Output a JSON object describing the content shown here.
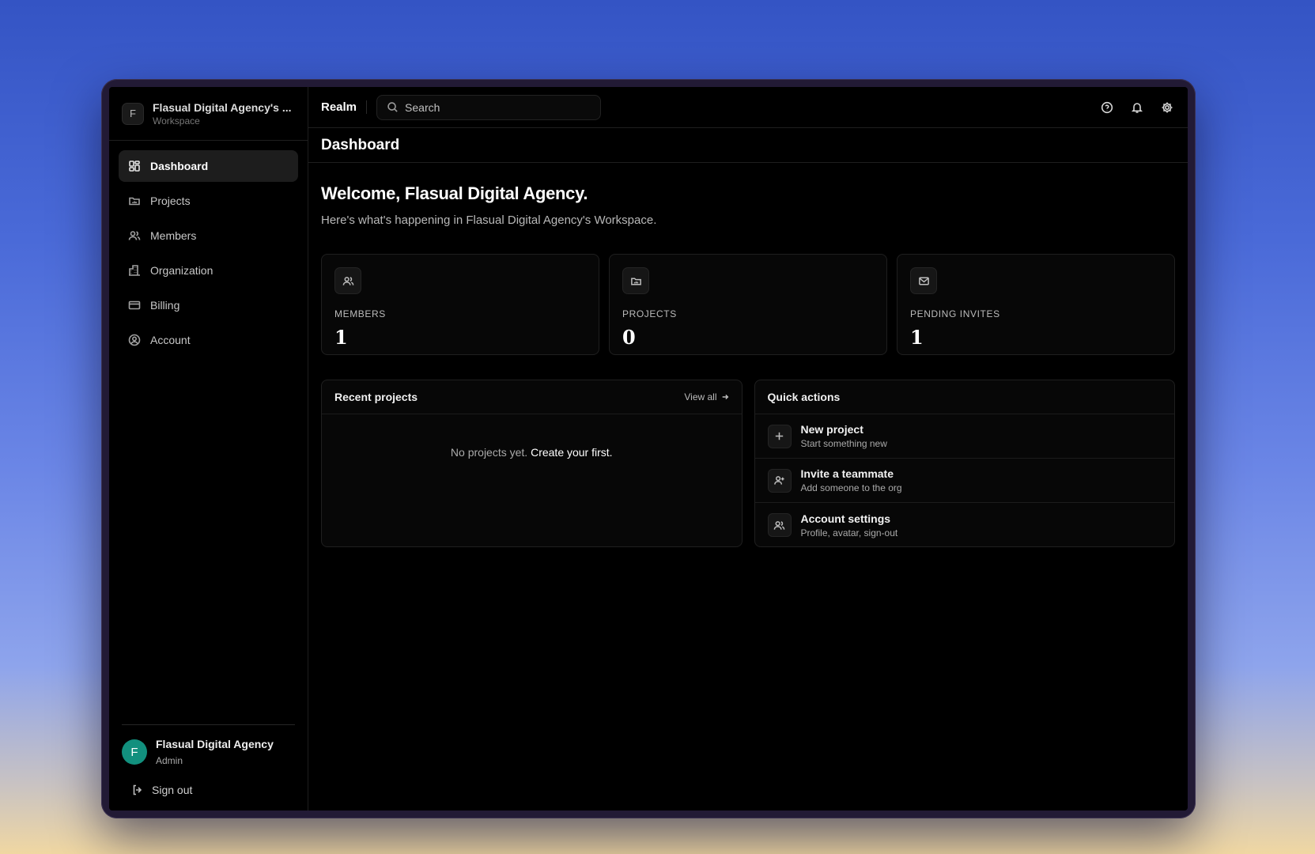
{
  "workspace": {
    "initial": "F",
    "name": "Flasual Digital Agency's ...",
    "subtitle": "Workspace"
  },
  "sidebar": {
    "items": [
      {
        "label": "Dashboard",
        "icon": "dashboard-icon",
        "active": true
      },
      {
        "label": "Projects",
        "icon": "folder-icon"
      },
      {
        "label": "Members",
        "icon": "users-icon"
      },
      {
        "label": "Organization",
        "icon": "building-icon"
      },
      {
        "label": "Billing",
        "icon": "credit-card-icon"
      },
      {
        "label": "Account",
        "icon": "user-circle-icon"
      }
    ]
  },
  "user": {
    "initial": "F",
    "name": "Flasual Digital Agency",
    "role": "Admin",
    "avatar_color": "#12907e"
  },
  "signout_label": "Sign out",
  "topbar": {
    "brand": "Realm",
    "search_placeholder": "Search",
    "icons": [
      "help-icon",
      "bell-icon",
      "settings-icon"
    ]
  },
  "page": {
    "title": "Dashboard",
    "welcome": "Welcome, Flasual Digital Agency.",
    "subtitle": "Here's what's happening in Flasual Digital Agency's Workspace."
  },
  "stats": [
    {
      "label": "MEMBERS",
      "value": "1",
      "icon": "users-icon"
    },
    {
      "label": "PROJECTS",
      "value": "0",
      "icon": "folder-icon"
    },
    {
      "label": "PENDING INVITES",
      "value": "1",
      "icon": "mail-icon"
    }
  ],
  "recent_projects": {
    "title": "Recent projects",
    "view_all": "View all",
    "empty_text": "No projects yet.",
    "empty_link": "Create your first."
  },
  "quick_actions": {
    "title": "Quick actions",
    "items": [
      {
        "title": "New project",
        "subtitle": "Start something new",
        "icon": "plus-icon"
      },
      {
        "title": "Invite a teammate",
        "subtitle": "Add someone to the org",
        "icon": "user-plus-icon"
      },
      {
        "title": "Account settings",
        "subtitle": "Profile, avatar, sign-out",
        "icon": "users-icon"
      }
    ]
  }
}
